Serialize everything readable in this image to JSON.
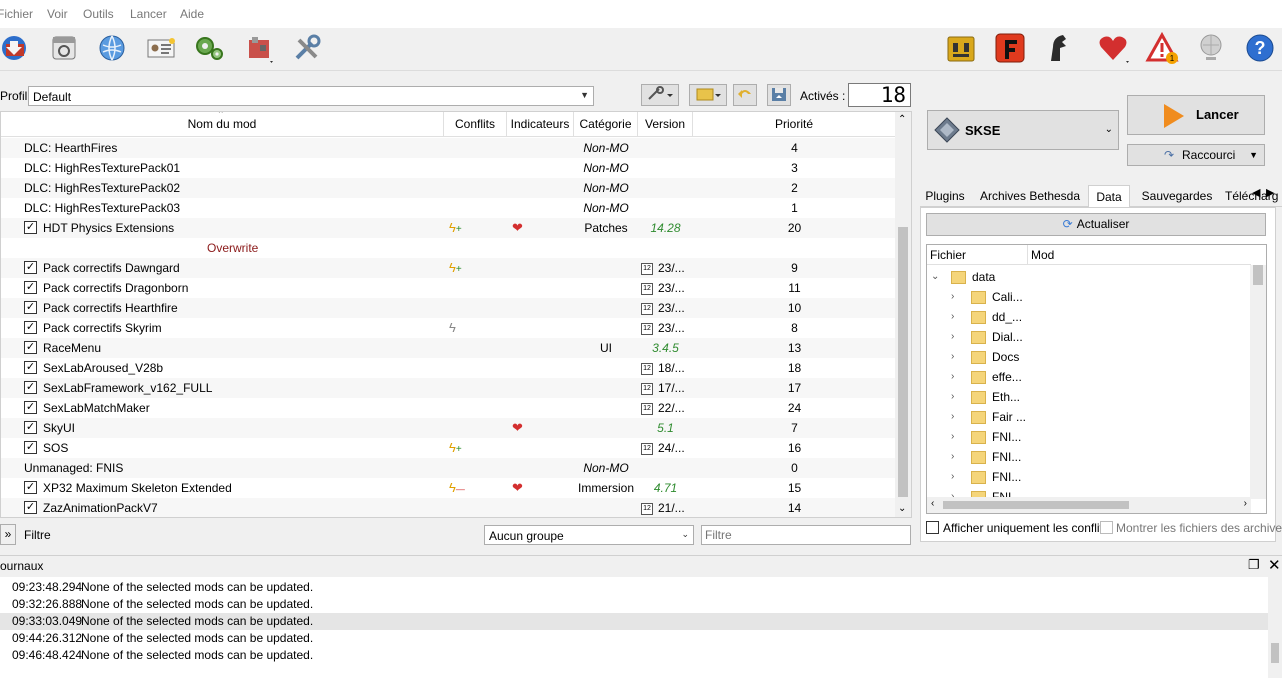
{
  "menu": [
    "Fichier",
    "Voir",
    "Outils",
    "Lancer",
    "Aide"
  ],
  "toolbar": {
    "left_icons": [
      "install-mod-icon",
      "nexus-icon",
      "browser-icon",
      "profiles-icon",
      "executables-icon",
      "tools-icon",
      "settings-icon"
    ],
    "right_icons": [
      "ini-editor-icon",
      "f-icon",
      "knight-icon",
      "heart-icon",
      "warning-icon",
      "network-icon",
      "help-icon"
    ],
    "warning_badge": "1"
  },
  "profile": {
    "label": "Profil",
    "value": "Default",
    "actives_label": "Activés :",
    "actives_count": "18"
  },
  "modlist": {
    "columns": [
      "Nom du mod",
      "Conflits",
      "Indicateurs",
      "Catégorie",
      "Version",
      "Priorité"
    ],
    "rows": [
      {
        "checkbox": false,
        "name": "DLC: HearthFires",
        "conflict": "",
        "indicator": "",
        "category": "Non-MO",
        "category_style": "italic",
        "version": "",
        "version_style": "",
        "priority": "4"
      },
      {
        "checkbox": false,
        "name": "DLC: HighResTexturePack01",
        "conflict": "",
        "indicator": "",
        "category": "Non-MO",
        "category_style": "italic",
        "version": "",
        "version_style": "",
        "priority": "3"
      },
      {
        "checkbox": false,
        "name": "DLC: HighResTexturePack02",
        "conflict": "",
        "indicator": "",
        "category": "Non-MO",
        "category_style": "italic",
        "version": "",
        "version_style": "",
        "priority": "2"
      },
      {
        "checkbox": false,
        "name": "DLC: HighResTexturePack03",
        "conflict": "",
        "indicator": "",
        "category": "Non-MO",
        "category_style": "italic",
        "version": "",
        "version_style": "",
        "priority": "1"
      },
      {
        "checkbox": true,
        "name": "HDT Physics Extensions",
        "conflict": "win-lose",
        "indicator": "heart",
        "category": "Patches",
        "category_style": "",
        "version": "14.28",
        "version_style": "green",
        "priority": "20"
      },
      {
        "checkbox": false,
        "name": "Overwrite",
        "conflict": "",
        "indicator": "",
        "category": "",
        "category_style": "",
        "version": "",
        "version_style": "",
        "priority": "",
        "overwrite": true
      },
      {
        "checkbox": true,
        "name": "Pack correctifs Dawngard",
        "conflict": "win-lose",
        "indicator": "",
        "category": "",
        "category_style": "",
        "version": "23/...",
        "version_style": "date",
        "priority": "9"
      },
      {
        "checkbox": true,
        "name": "Pack correctifs Dragonborn",
        "conflict": "",
        "indicator": "",
        "category": "",
        "category_style": "",
        "version": "23/...",
        "version_style": "date",
        "priority": "11"
      },
      {
        "checkbox": true,
        "name": "Pack correctifs Hearthfire",
        "conflict": "",
        "indicator": "",
        "category": "",
        "category_style": "",
        "version": "23/...",
        "version_style": "date",
        "priority": "10"
      },
      {
        "checkbox": true,
        "name": "Pack correctifs Skyrim",
        "conflict": "gray",
        "indicator": "",
        "category": "",
        "category_style": "",
        "version": "23/...",
        "version_style": "date",
        "priority": "8"
      },
      {
        "checkbox": true,
        "name": "RaceMenu",
        "conflict": "",
        "indicator": "",
        "category": "UI",
        "category_style": "",
        "version": "3.4.5",
        "version_style": "green",
        "priority": "13"
      },
      {
        "checkbox": true,
        "name": "SexLabAroused_V28b",
        "conflict": "",
        "indicator": "",
        "category": "",
        "category_style": "",
        "version": "18/...",
        "version_style": "date",
        "priority": "18"
      },
      {
        "checkbox": true,
        "name": "SexLabFramework_v162_FULL",
        "conflict": "",
        "indicator": "",
        "category": "",
        "category_style": "",
        "version": "17/...",
        "version_style": "date",
        "priority": "17"
      },
      {
        "checkbox": true,
        "name": "SexLabMatchMaker",
        "conflict": "",
        "indicator": "",
        "category": "",
        "category_style": "",
        "version": "22/...",
        "version_style": "date",
        "priority": "24"
      },
      {
        "checkbox": true,
        "name": "SkyUI",
        "conflict": "",
        "indicator": "heart",
        "category": "",
        "category_style": "",
        "version": "5.1",
        "version_style": "green",
        "priority": "7"
      },
      {
        "checkbox": true,
        "name": "SOS",
        "conflict": "win-lose",
        "indicator": "",
        "category": "",
        "category_style": "",
        "version": "24/...",
        "version_style": "date",
        "priority": "16"
      },
      {
        "checkbox": false,
        "name": "Unmanaged: FNIS",
        "conflict": "",
        "indicator": "",
        "category": "Non-MO",
        "category_style": "italic",
        "version": "",
        "version_style": "",
        "priority": "0"
      },
      {
        "checkbox": true,
        "name": "XP32 Maximum Skeleton Extended",
        "conflict": "win-red",
        "indicator": "heart",
        "category": "Immersion",
        "category_style": "",
        "version": "4.71",
        "version_style": "green",
        "priority": "15"
      },
      {
        "checkbox": true,
        "name": "ZazAnimationPackV7",
        "conflict": "",
        "indicator": "",
        "category": "",
        "category_style": "",
        "version": "21/...",
        "version_style": "date",
        "priority": "14"
      }
    ]
  },
  "filterbar": {
    "toggle": "»",
    "filter_label": "Filtre",
    "group_value": "Aucun groupe",
    "filter_placeholder": "Filtre"
  },
  "launcher": {
    "executable": "SKSE",
    "run_label": "Lancer",
    "shortcut_label": "Raccourci"
  },
  "right_tabs": [
    "Plugins",
    "Archives Bethesda",
    "Data",
    "Sauvegardes",
    "Télécharg"
  ],
  "data_tab": {
    "refresh_label": "Actualiser",
    "columns": [
      "Fichier",
      "Mod"
    ],
    "root": "data",
    "folders": [
      "Cali...",
      "dd_...",
      "Dial...",
      "Docs",
      "effe...",
      "Eth...",
      "Fair ...",
      "FNI...",
      "FNI...",
      "FNI...",
      "FNI..."
    ],
    "only_conflicts_label": "Afficher uniquement les conflits",
    "show_archives_label": "Montrer les fichiers des archive"
  },
  "logs": {
    "title": "ournaux",
    "entries": [
      {
        "time": "09:23:48.294",
        "message": "None of the selected mods can be updated.",
        "selected": false
      },
      {
        "time": "09:32:26.888",
        "message": "None of the selected mods can be updated.",
        "selected": false
      },
      {
        "time": "09:33:03.049",
        "message": "None of the selected mods can be updated.",
        "selected": true
      },
      {
        "time": "09:44:26.312",
        "message": "None of the selected mods can be updated.",
        "selected": false
      },
      {
        "time": "09:46:48.424",
        "message": "None of the selected mods can be updated.",
        "selected": false
      }
    ]
  },
  "colors": {
    "green_version": "#2e8b2e",
    "overwrite": "#8b1a1a",
    "heart": "#d32f2f",
    "lancer_arrow": "#f08c1e"
  }
}
